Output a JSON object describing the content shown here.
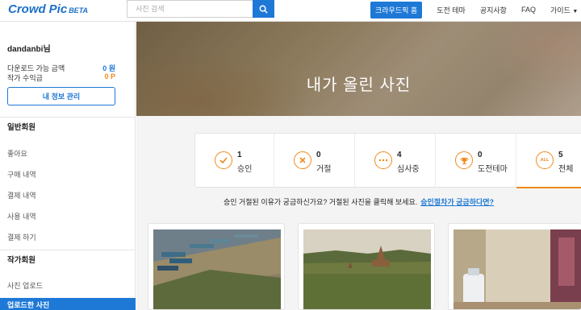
{
  "header": {
    "logo_word1": "Crowd",
    "logo_word2": "Pic",
    "logo_badge": "BETA",
    "search_placeholder": "사진 검색",
    "nav": {
      "crowdpick_home": "크라우드픽 홈",
      "challenge_theme": "도전 테마",
      "notice": "공지사항",
      "faq": "FAQ",
      "guide": "가이드"
    }
  },
  "sidebar": {
    "username": "dandanbi님",
    "download_label": "다운로드 가능 금액",
    "download_value": "0 원",
    "earnings_label": "작가 수익금",
    "earnings_value": "0 P",
    "myinfo_button": "내 정보 관리",
    "general_section": "일반회원",
    "general_items": [
      "좋아요",
      "구매 내역",
      "결제 내역",
      "사용 내역",
      "결제 하기"
    ],
    "author_section": "작가회원",
    "author_items": [
      "사진 업로드",
      "업로드한 사진"
    ]
  },
  "hero": {
    "title": "내가 올린 사진"
  },
  "status": [
    {
      "count": "1",
      "label": "승인",
      "icon": "check-icon"
    },
    {
      "count": "0",
      "label": "거절",
      "icon": "x-icon"
    },
    {
      "count": "4",
      "label": "심사중",
      "icon": "dots-icon"
    },
    {
      "count": "0",
      "label": "도전테마",
      "icon": "trophy-icon"
    },
    {
      "count": "5",
      "label": "전체",
      "icon": "all-icon",
      "icon_text": "ALL"
    }
  ],
  "notice": {
    "text": "승인 거절된 이유가 궁금하신가요? 거절된 사진을 클릭해 보세요.",
    "link": "승인절차가 궁금하다면?"
  },
  "colors": {
    "primary": "#1e78d6",
    "accent": "#f08a1c"
  }
}
